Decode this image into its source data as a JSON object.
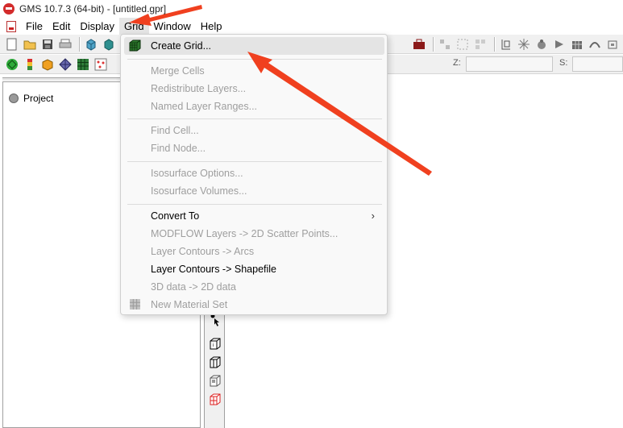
{
  "window": {
    "title": "GMS 10.7.3 (64-bit) - [untitled.gpr]"
  },
  "menubar": {
    "items": [
      {
        "label": "File"
      },
      {
        "label": "Edit"
      },
      {
        "label": "Display"
      },
      {
        "label": "Grid"
      },
      {
        "label": "Window"
      },
      {
        "label": "Help"
      }
    ],
    "open_menu": "Grid"
  },
  "coords": {
    "z_label": "Z:",
    "s_label": "S:"
  },
  "project_tree": {
    "root_label": "Project"
  },
  "grid_menu": {
    "items": [
      {
        "label": "Create Grid...",
        "enabled": true,
        "highlighted": true,
        "icon": "grid-cube-icon"
      },
      {
        "label": "Merge Cells",
        "enabled": false
      },
      {
        "label": "Redistribute Layers...",
        "enabled": false
      },
      {
        "label": "Named Layer Ranges...",
        "enabled": false
      },
      {
        "label": "Find Cell...",
        "enabled": false
      },
      {
        "label": "Find Node...",
        "enabled": false
      },
      {
        "label": "Isosurface Options...",
        "enabled": false
      },
      {
        "label": "Isosurface Volumes...",
        "enabled": false
      },
      {
        "label": "Convert To",
        "enabled": true,
        "submenu": true
      },
      {
        "label": "MODFLOW Layers -> 2D Scatter Points...",
        "enabled": false
      },
      {
        "label": "Layer Contours -> Arcs",
        "enabled": false
      },
      {
        "label": "Layer Contours -> Shapefile",
        "enabled": true
      },
      {
        "label": "3D data -> 2D data",
        "enabled": false
      },
      {
        "label": "New Material Set",
        "enabled": false,
        "icon": "material-grid-icon"
      }
    ],
    "submenu_arrow": "›"
  },
  "annotations": {
    "arrow_color": "#f0401f"
  },
  "colors": {
    "menu_bg": "#f9f9f9",
    "highlight": "#e4e4e4",
    "disabled_text": "#9e9e9e"
  }
}
